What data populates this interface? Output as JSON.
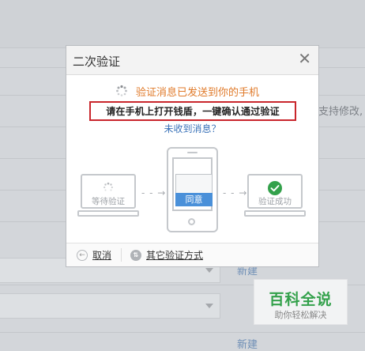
{
  "background": {
    "right_note": "支持修改,",
    "new_link_1": "新建",
    "new_link_2": "新建"
  },
  "dialog": {
    "title": "二次验证",
    "close_icon": "close-icon",
    "status_text": "验证消息已发送到你的手机",
    "hint": "请在手机上打开钱盾，一键确认通过验证",
    "resend_link": "未收到消息？",
    "steps": {
      "waiting_label": "等待验证",
      "agree_label": "同意",
      "success_label": "验证成功"
    },
    "footer": {
      "cancel_label": "取消",
      "other_method_label": "其它验证方式"
    }
  },
  "watermark": {
    "title": "百科全说",
    "subtitle": "助你轻松解决"
  },
  "colors": {
    "status_orange": "#e07a2a",
    "hint_border_red": "#c9262c",
    "link_blue": "#3b73b9",
    "agree_blue": "#4a90d9",
    "success_green": "#33a14b"
  }
}
